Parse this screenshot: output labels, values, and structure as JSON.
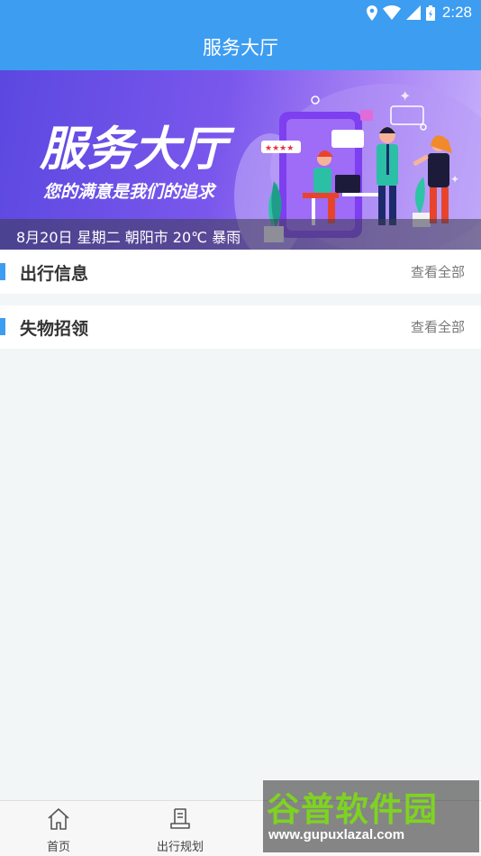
{
  "status_bar": {
    "time": "2:28",
    "icons": [
      "location-icon",
      "wifi-icon",
      "signal-icon",
      "battery-icon"
    ]
  },
  "app_bar": {
    "title": "服务大厅"
  },
  "banner": {
    "headline": "服务大厅",
    "slogan": "您的满意是我们的追求",
    "caption": "8月20日 星期二 朝阳市 20℃ 暴雨"
  },
  "sections": [
    {
      "title": "出行信息",
      "more_label": "查看全部"
    },
    {
      "title": "失物招领",
      "more_label": "查看全部"
    }
  ],
  "tab_bar": {
    "tabs": [
      {
        "label": "首页",
        "icon": "home-icon"
      },
      {
        "label": "出行规划",
        "icon": "route-plan-icon"
      }
    ]
  },
  "watermark": {
    "name": "谷普软件园",
    "url": "www.gupuxlazal.com"
  },
  "colors": {
    "primary": "#3d9df0",
    "background": "#f3f6f7",
    "watermark_green": "#7ed321"
  }
}
